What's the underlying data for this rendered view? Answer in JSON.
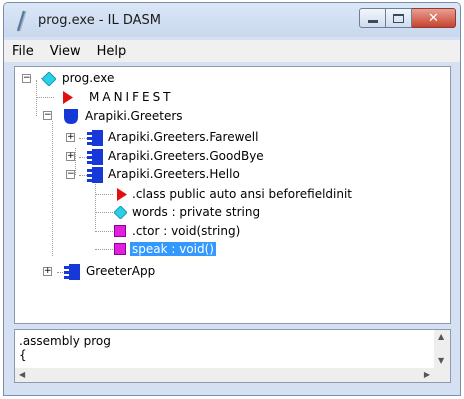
{
  "window": {
    "title": "prog.exe - IL DASM",
    "accent_color": "#c7432f"
  },
  "menu": {
    "items": [
      "File",
      "View",
      "Help"
    ]
  },
  "tree": {
    "root": "prog.exe",
    "manifest": "MANIFEST",
    "namespace": "Arapiki.Greeters",
    "classes": [
      "Arapiki.Greeters.Farewell",
      "Arapiki.Greeters.GoodBye",
      "Arapiki.Greeters.Hello"
    ],
    "hello_members": [
      ".class public auto ansi beforefieldinit",
      "words : private string",
      ".ctor : void(string)",
      "speak : void()"
    ],
    "app_class": "GreeterApp"
  },
  "detail": {
    "line1": ".assembly prog",
    "line2": "{"
  }
}
